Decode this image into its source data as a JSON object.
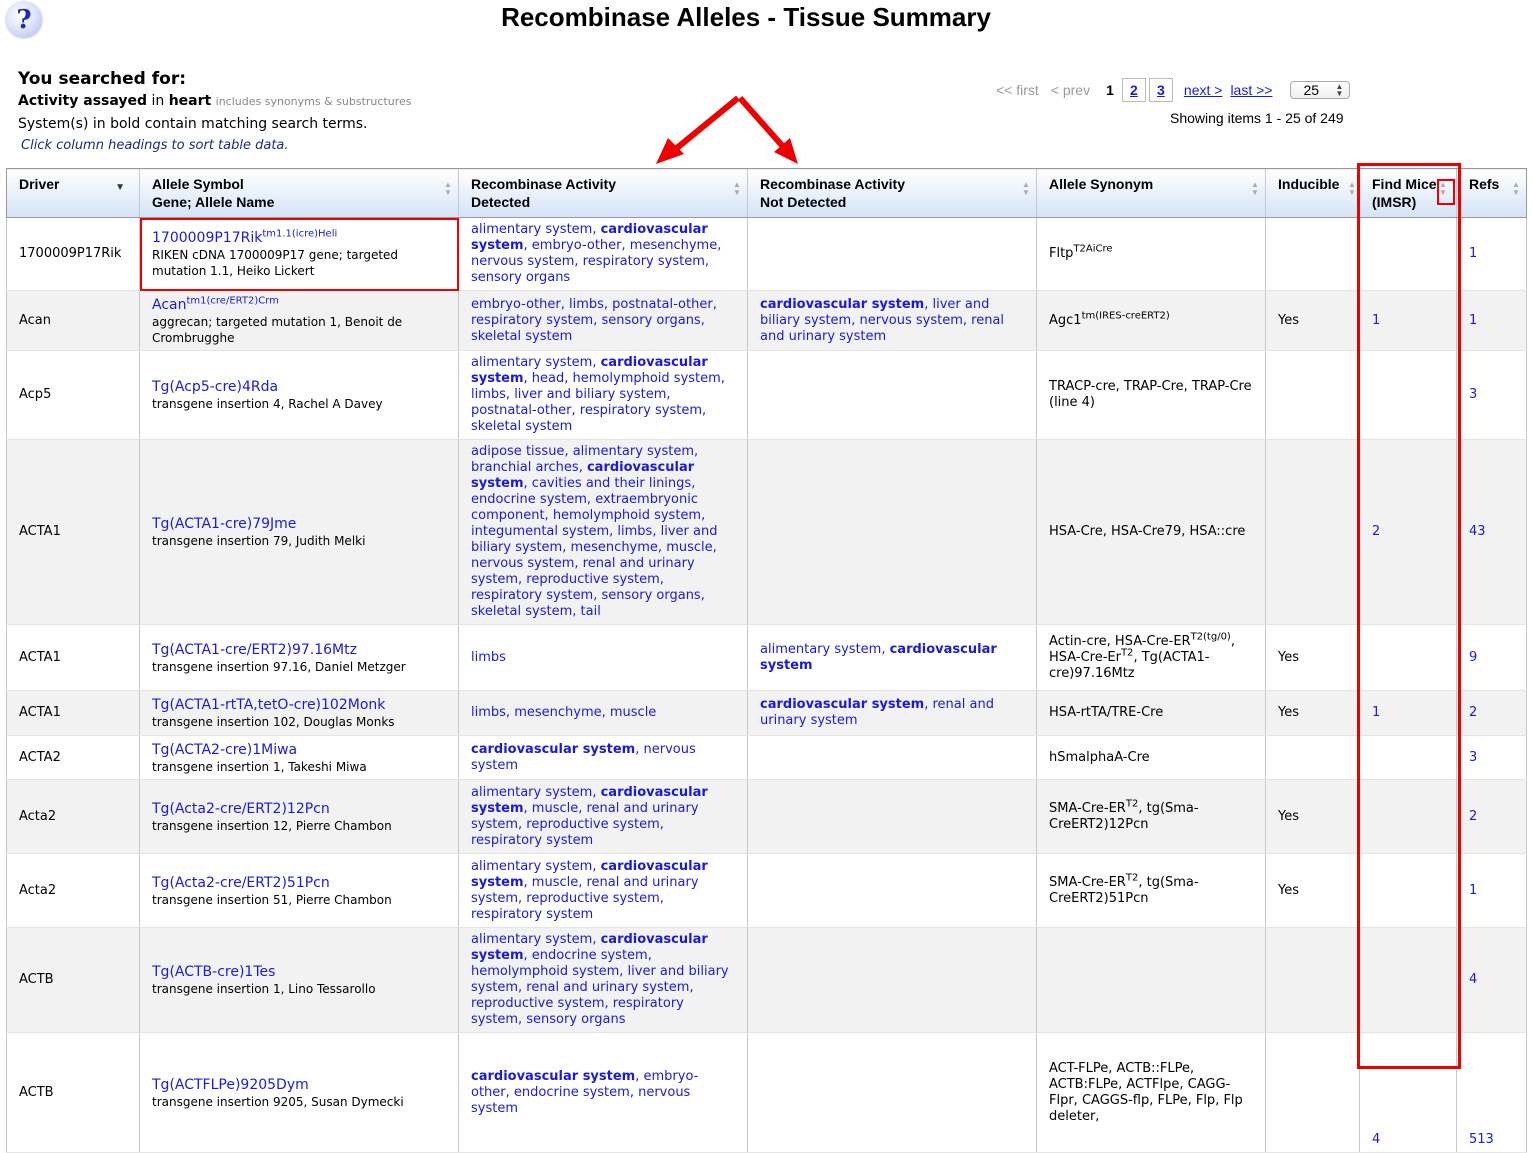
{
  "header": {
    "help_icon": "?",
    "title": "Recombinase Alleles - Tissue Summary"
  },
  "search": {
    "heading": "You searched for:",
    "criteria_label": "Activity assayed",
    "criteria_in": "in",
    "criteria_term": "heart",
    "criteria_note": "includes synonyms & substructures",
    "bold_note": "System(s) in bold contain matching search terms.",
    "sort_hint": "Click column headings to sort table data."
  },
  "pager": {
    "first": "<< first",
    "prev": "< prev",
    "current": "1",
    "pages": [
      "2",
      "3"
    ],
    "next": "next >",
    "last": "last >>",
    "page_size": "25",
    "showing": "Showing items 1 - 25 of 249"
  },
  "columns": {
    "driver": "Driver",
    "allele_l1": "Allele Symbol",
    "allele_l2": "Gene; Allele Name",
    "detected_l1": "Recombinase Activity",
    "detected_l2": "Detected",
    "notdetected_l1": "Recombinase Activity",
    "notdetected_l2": "Not Detected",
    "synonym": "Allele Synonym",
    "inducible": "Inducible",
    "findmice_l1": "Find Mice",
    "findmice_l2": "(IMSR)",
    "refs": "Refs"
  },
  "rows": [
    {
      "driver": "1700009P17Rik",
      "symbol_base": "1700009P17Rik",
      "symbol_sup": "tm1.1(icre)Heli",
      "gene_name": "RIKEN cDNA 1700009P17 gene; targeted mutation 1.1, Heiko Lickert",
      "detected": [
        [
          "alimentary system",
          false
        ],
        [
          "cardiovascular system",
          true
        ],
        [
          "embryo-other",
          false
        ],
        [
          "mesenchyme",
          false
        ],
        [
          "nervous system",
          false
        ],
        [
          "respiratory system",
          false
        ],
        [
          "sensory organs",
          false
        ]
      ],
      "not_detected": [],
      "synonym": [
        [
          "Fltp",
          "T2AiCre"
        ]
      ],
      "inducible": "",
      "find_mice": "",
      "refs": "1"
    },
    {
      "driver": "Acan",
      "symbol_base": "Acan",
      "symbol_sup": "tm1(cre/ERT2)Crm",
      "gene_name": "aggrecan; targeted mutation 1, Benoit de Crombrugghe",
      "detected": [
        [
          "embryo-other",
          false
        ],
        [
          "limbs",
          false
        ],
        [
          "postnatal-other",
          false
        ],
        [
          "respiratory system",
          false
        ],
        [
          "sensory organs",
          false
        ],
        [
          "skeletal system",
          false
        ]
      ],
      "not_detected": [
        [
          "cardiovascular system",
          true
        ],
        [
          "liver and biliary system",
          false
        ],
        [
          "nervous system",
          false
        ],
        [
          "renal and urinary system",
          false
        ]
      ],
      "synonym": [
        [
          "Agc1",
          "tm(IRES-creERT2)"
        ]
      ],
      "inducible": "Yes",
      "find_mice": "1",
      "refs": "1"
    },
    {
      "driver": "Acp5",
      "symbol_base": "Tg(Acp5-cre)4Rda",
      "symbol_sup": "",
      "gene_name": "transgene insertion 4, Rachel A Davey",
      "detected": [
        [
          "alimentary system",
          false
        ],
        [
          "cardiovascular system",
          true
        ],
        [
          "head",
          false
        ],
        [
          "hemolymphoid system",
          false
        ],
        [
          "limbs",
          false
        ],
        [
          "liver and biliary system",
          false
        ],
        [
          "postnatal-other",
          false
        ],
        [
          "respiratory system",
          false
        ],
        [
          "skeletal system",
          false
        ]
      ],
      "not_detected": [],
      "synonym": [
        [
          "TRACP-cre, TRAP-Cre, TRAP-Cre (line 4)",
          ""
        ]
      ],
      "inducible": "",
      "find_mice": "",
      "refs": "3"
    },
    {
      "driver": "ACTA1",
      "symbol_base": "Tg(ACTA1-cre)79Jme",
      "symbol_sup": "",
      "gene_name": "transgene insertion 79, Judith Melki",
      "detected": [
        [
          "adipose tissue",
          false
        ],
        [
          "alimentary system",
          false
        ],
        [
          "branchial arches",
          false
        ],
        [
          "cardiovascular system",
          true
        ],
        [
          "cavities and their linings",
          false
        ],
        [
          "endocrine system",
          false
        ],
        [
          "extraembryonic component",
          false
        ],
        [
          "hemolymphoid system",
          false
        ],
        [
          "integumental system",
          false
        ],
        [
          "limbs",
          false
        ],
        [
          "liver and biliary system",
          false
        ],
        [
          "mesenchyme",
          false
        ],
        [
          "muscle",
          false
        ],
        [
          "nervous system",
          false
        ],
        [
          "renal and urinary system",
          false
        ],
        [
          "reproductive system",
          false
        ],
        [
          "respiratory system",
          false
        ],
        [
          "sensory organs",
          false
        ],
        [
          "skeletal system",
          false
        ],
        [
          "tail",
          false
        ]
      ],
      "not_detected": [],
      "synonym": [
        [
          "HSA-Cre, HSA-Cre79, HSA::cre",
          ""
        ]
      ],
      "inducible": "",
      "find_mice": "2",
      "refs": "43"
    },
    {
      "driver": "ACTA1",
      "symbol_base": "Tg(ACTA1-cre/ERT2)97.16Mtz",
      "symbol_sup": "",
      "gene_name": "transgene insertion 97.16, Daniel Metzger",
      "detected": [
        [
          "limbs",
          false
        ]
      ],
      "not_detected": [
        [
          "alimentary system",
          false
        ],
        [
          "cardiovascular system",
          true
        ]
      ],
      "synonym": [
        [
          "Actin-cre, HSA-Cre-ER",
          "T2(tg/0)"
        ],
        [
          ", HSA-Cre-Er",
          "T2"
        ],
        [
          ", Tg(ACTA1-cre)97.16Mtz",
          ""
        ]
      ],
      "inducible": "Yes",
      "find_mice": "",
      "refs": "9"
    },
    {
      "driver": "ACTA1",
      "symbol_base": "Tg(ACTA1-rtTA,tetO-cre)102Monk",
      "symbol_sup": "",
      "gene_name": "transgene insertion 102, Douglas Monks",
      "detected": [
        [
          "limbs",
          false
        ],
        [
          "mesenchyme",
          false
        ],
        [
          "muscle",
          false
        ]
      ],
      "not_detected": [
        [
          "cardiovascular system",
          true
        ],
        [
          "renal and urinary system",
          false
        ]
      ],
      "synonym": [
        [
          "HSA-rtTA/TRE-Cre",
          ""
        ]
      ],
      "inducible": "Yes",
      "find_mice": "1",
      "refs": "2"
    },
    {
      "driver": "ACTA2",
      "symbol_base": "Tg(ACTA2-cre)1Miwa",
      "symbol_sup": "",
      "gene_name": "transgene insertion 1, Takeshi Miwa",
      "detected": [
        [
          "cardiovascular system",
          true
        ],
        [
          "nervous system",
          false
        ]
      ],
      "not_detected": [],
      "synonym": [
        [
          "hSmalphaA-Cre",
          ""
        ]
      ],
      "inducible": "",
      "find_mice": "",
      "refs": "3"
    },
    {
      "driver": "Acta2",
      "symbol_base": "Tg(Acta2-cre/ERT2)12Pcn",
      "symbol_sup": "",
      "gene_name": "transgene insertion 12, Pierre Chambon",
      "detected": [
        [
          "alimentary system",
          false
        ],
        [
          "cardiovascular system",
          true
        ],
        [
          "muscle",
          false
        ],
        [
          "renal and urinary system",
          false
        ],
        [
          "reproductive system",
          false
        ],
        [
          "respiratory system",
          false
        ]
      ],
      "not_detected": [],
      "synonym": [
        [
          "SMA-Cre-ER",
          "T2"
        ],
        [
          ", tg(Sma-CreERT2)12Pcn",
          ""
        ]
      ],
      "inducible": "Yes",
      "find_mice": "",
      "refs": "2"
    },
    {
      "driver": "Acta2",
      "symbol_base": "Tg(Acta2-cre/ERT2)51Pcn",
      "symbol_sup": "",
      "gene_name": "transgene insertion 51, Pierre Chambon",
      "detected": [
        [
          "alimentary system",
          false
        ],
        [
          "cardiovascular system",
          true
        ],
        [
          "muscle",
          false
        ],
        [
          "renal and urinary system",
          false
        ],
        [
          "reproductive system",
          false
        ],
        [
          "respiratory system",
          false
        ]
      ],
      "not_detected": [],
      "synonym": [
        [
          "SMA-Cre-ER",
          "T2"
        ],
        [
          ", tg(Sma-CreERT2)51Pcn",
          ""
        ]
      ],
      "inducible": "Yes",
      "find_mice": "",
      "refs": "1"
    },
    {
      "driver": "ACTB",
      "symbol_base": "Tg(ACTB-cre)1Tes",
      "symbol_sup": "",
      "gene_name": "transgene insertion 1, Lino Tessarollo",
      "detected": [
        [
          "alimentary system",
          false
        ],
        [
          "cardiovascular system",
          true
        ],
        [
          "endocrine system",
          false
        ],
        [
          "hemolymphoid system",
          false
        ],
        [
          "liver and biliary system",
          false
        ],
        [
          "renal and urinary system",
          false
        ],
        [
          "reproductive system",
          false
        ],
        [
          "respiratory system",
          false
        ],
        [
          "sensory organs",
          false
        ]
      ],
      "not_detected": [],
      "synonym": [],
      "inducible": "",
      "find_mice": "",
      "refs": "4"
    },
    {
      "driver": "ACTB",
      "symbol_base": "Tg(ACTFLPe)9205Dym",
      "symbol_sup": "",
      "gene_name": "transgene insertion 9205, Susan Dymecki",
      "detected": [
        [
          "cardiovascular system",
          true
        ],
        [
          "embryo-other",
          false
        ],
        [
          "endocrine system",
          false
        ],
        [
          "nervous system",
          false
        ]
      ],
      "not_detected": [],
      "synonym": [
        [
          "ACT-FLPe, ACTB::FLPe, ACTB:FLPe, ACTFlpe, CAGG-Flpr, CAGGS-flp, FLPe, Flp, Flp deleter,",
          ""
        ]
      ],
      "inducible": "",
      "find_mice": "4",
      "refs": "513"
    }
  ],
  "colors": {
    "link": "#1a1adb",
    "annotation": "#ee0000",
    "header_gradient_bottom": "#d4e3f7",
    "alt_row": "#f2f2f2"
  }
}
